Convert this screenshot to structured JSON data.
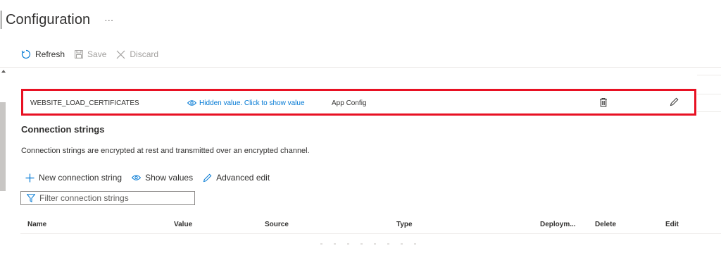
{
  "header": {
    "title": "Configuration",
    "more": "···"
  },
  "toolbar": {
    "refresh": "Refresh",
    "save": "Save",
    "discard": "Discard"
  },
  "setting_row": {
    "name": "WEBSITE_LOAD_CERTIFICATES",
    "value": "Hidden value. Click to show value",
    "source": "App Config"
  },
  "connection_strings": {
    "title": "Connection strings",
    "description": "Connection strings are encrypted at rest and transmitted over an encrypted channel.",
    "actions": {
      "new": "New connection string",
      "show": "Show values",
      "advanced": "Advanced edit"
    },
    "filter_placeholder": "Filter connection strings",
    "columns": {
      "name": "Name",
      "value": "Value",
      "source": "Source",
      "type": "Type",
      "deploy": "Deploym...",
      "delete": "Delete",
      "edit": "Edit"
    }
  },
  "colors": {
    "accent": "#0078d4",
    "highlight": "#e81123",
    "text": "#323130"
  }
}
